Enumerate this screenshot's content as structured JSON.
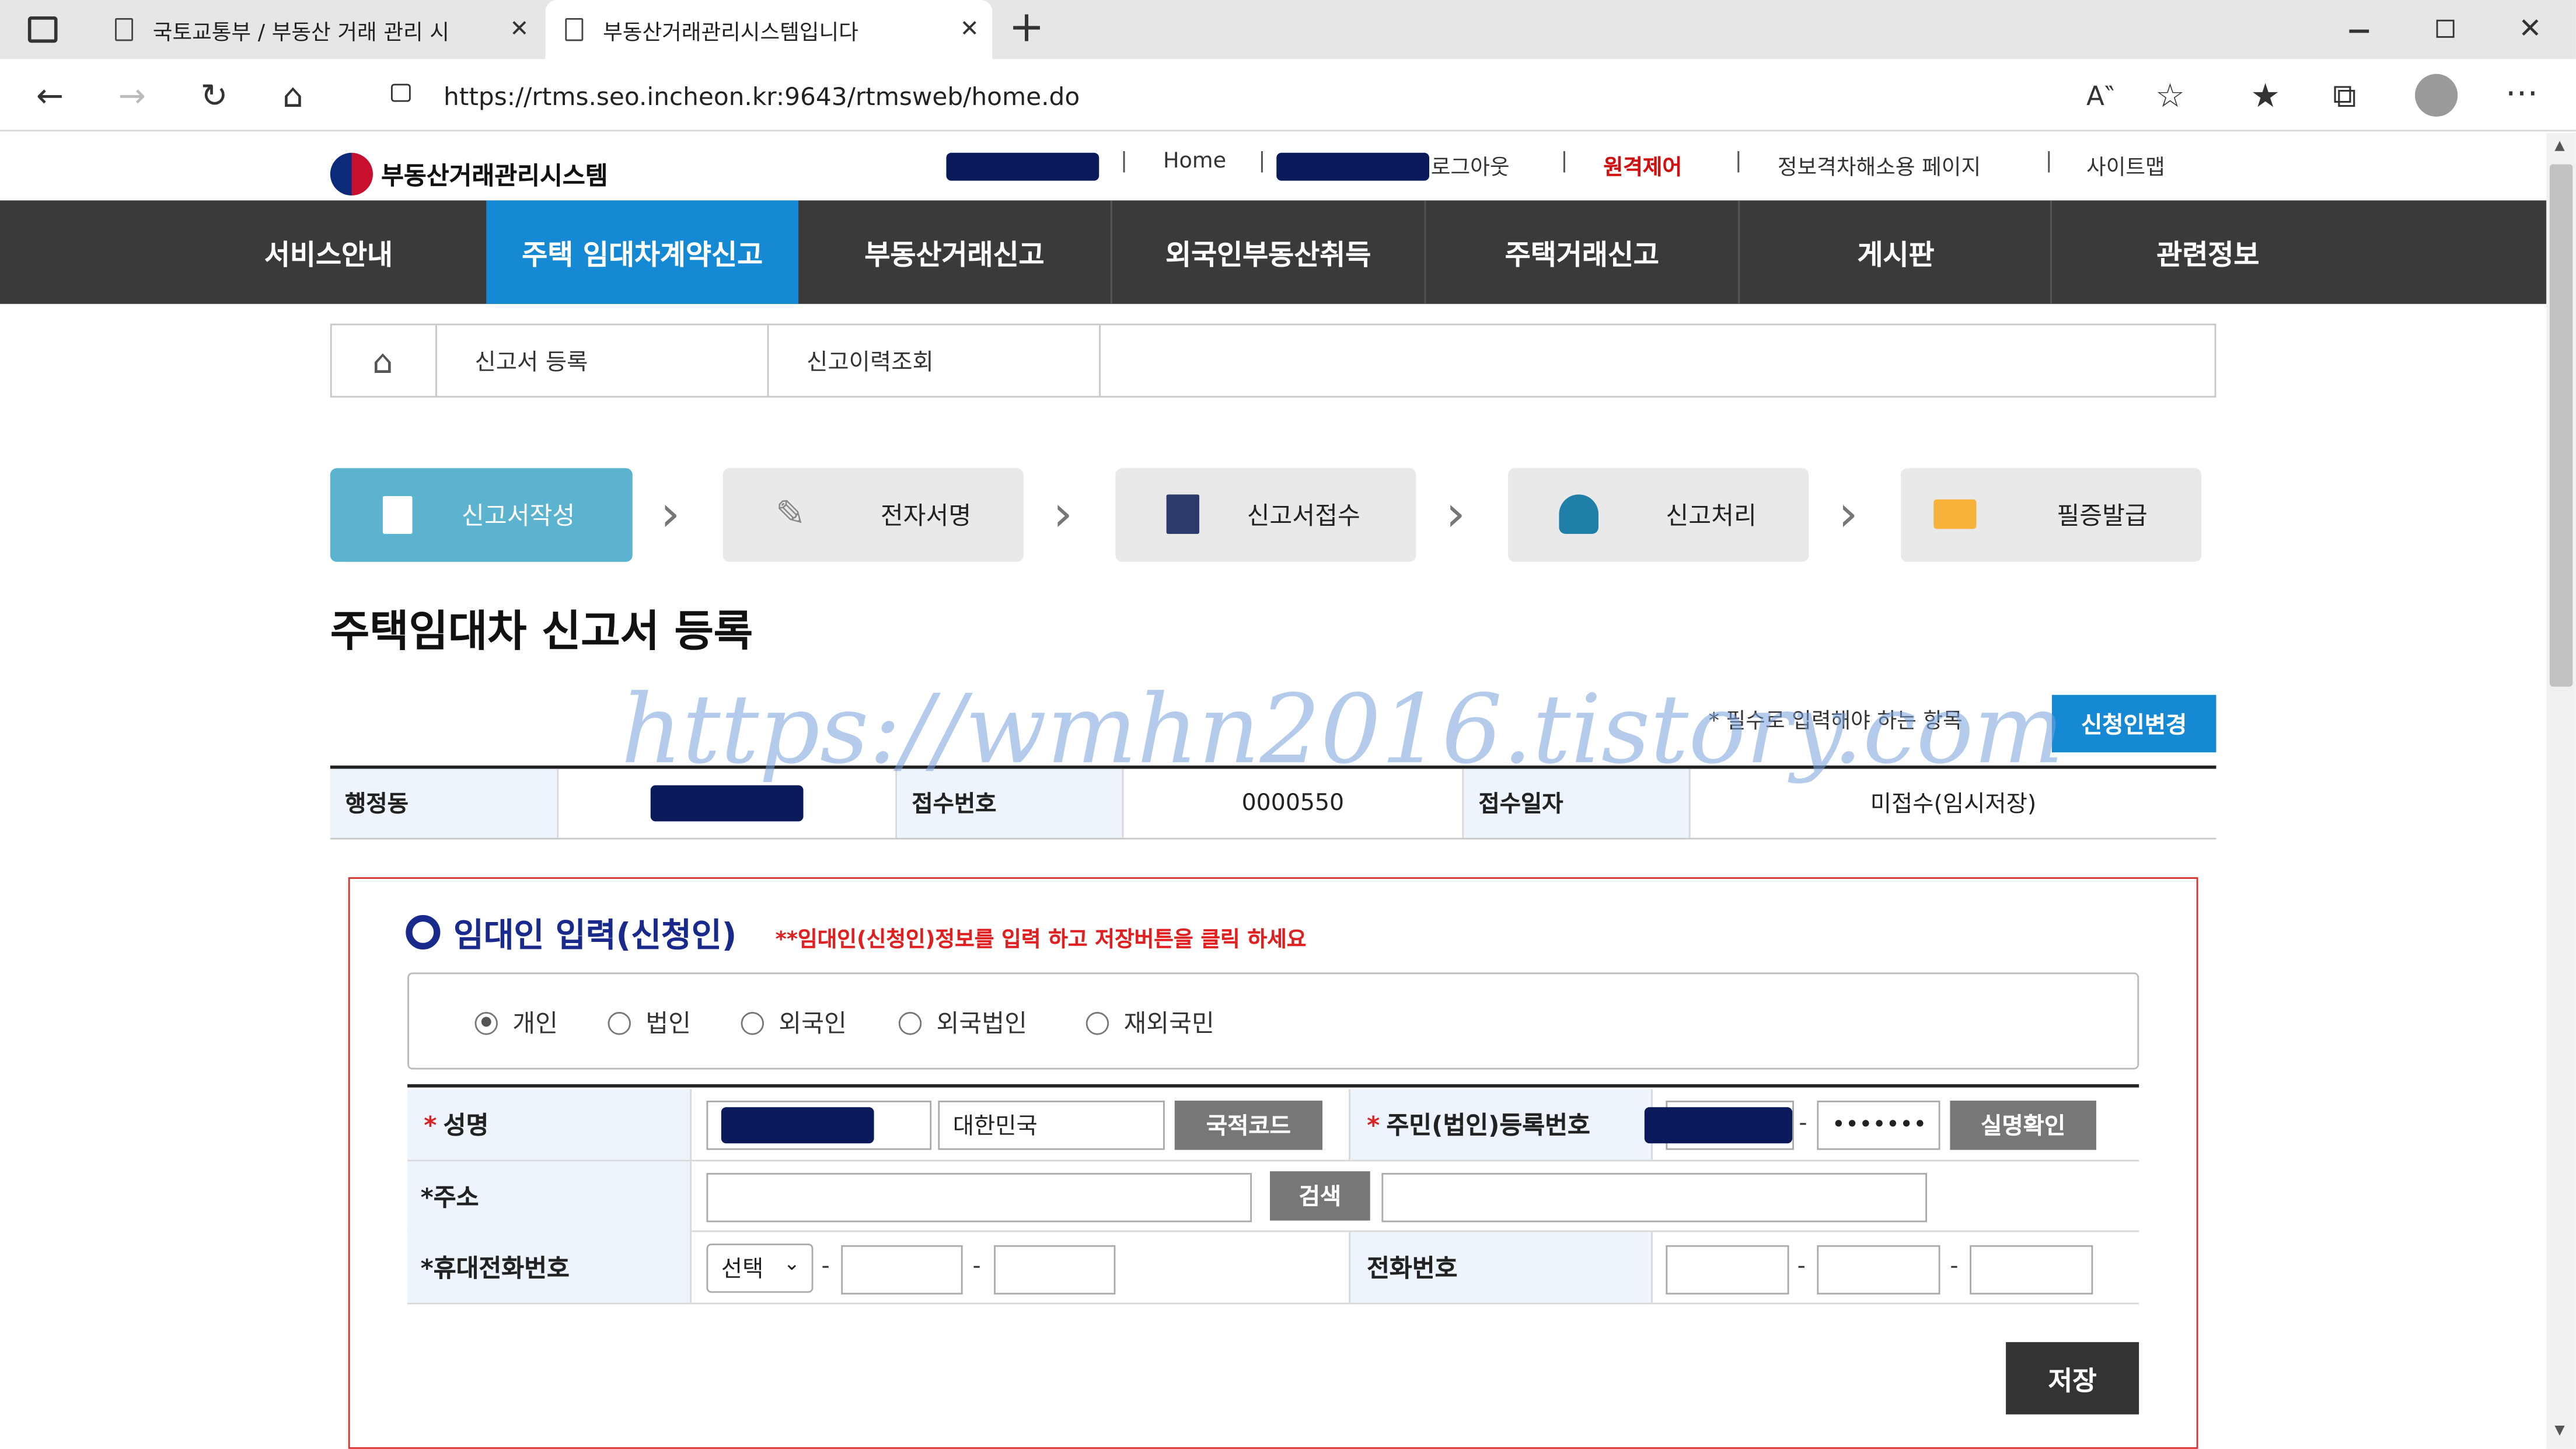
{
  "browser": {
    "tabs": [
      {
        "title": "국토교통부 / 부동산 거래 관리 시"
      },
      {
        "title": "부동산거래관리시스템입니다"
      }
    ],
    "url": "https://rtms.seo.incheon.kr:9643/rtmsweb/home.do",
    "close_glyph": "✕",
    "add_glyph": "+"
  },
  "site": {
    "logo_text": "부동산거래관리시스템",
    "util_links": [
      {
        "label": "Home"
      },
      {
        "label": "로그아웃"
      },
      {
        "label": "원격제어"
      },
      {
        "label": "정보격차해소용 페이지"
      },
      {
        "label": "사이트맵"
      }
    ],
    "gnb": [
      {
        "label": "서비스안내"
      },
      {
        "label": "주택 임대차계약신고"
      },
      {
        "label": "부동산거래신고"
      },
      {
        "label": "외국인부동산취득"
      },
      {
        "label": "주택거래신고"
      },
      {
        "label": "게시판"
      },
      {
        "label": "관련정보"
      }
    ],
    "lnb": [
      {
        "label": "신고서 등록"
      },
      {
        "label": "신고이력조회"
      }
    ]
  },
  "steps": [
    {
      "label": "신고서작성"
    },
    {
      "label": "전자서명"
    },
    {
      "label": "신고서접수"
    },
    {
      "label": "신고처리"
    },
    {
      "label": "필증발급"
    }
  ],
  "page": {
    "title": "주택임대차 신고서 등록",
    "required_note": "* 필수로 입력해야 하는 항목",
    "change_applicant": "신청인변경",
    "watermark": "https://wmhn2016.tistory.com"
  },
  "info": {
    "dong_label": "행정동",
    "receipt_no_label": "접수번호",
    "receipt_no": "0000550",
    "receipt_date_label": "접수일자",
    "receipt_date": "미접수(임시저장)"
  },
  "section": {
    "title": "임대인 입력(신청인)",
    "note": "**임대인(신청인)정보를 입력 하고 저장버튼을 클릭 하세요",
    "types": [
      {
        "label": "개인",
        "checked": true
      },
      {
        "label": "법인"
      },
      {
        "label": "외국인"
      },
      {
        "label": "외국법인"
      },
      {
        "label": "재외국민"
      }
    ]
  },
  "form": {
    "name_label": "성명",
    "nationality": "대한민국",
    "nation_code_btn": "국적코드",
    "reg_no_label": "주민(법인)등록번호",
    "reg_no_masked": "•••••••",
    "verify_btn": "실명확인",
    "address_label": "*주소",
    "search_btn": "검색",
    "mobile_label": "*휴대전화번호",
    "mobile_select": "선택",
    "phone_label": "전화번호",
    "dash": "-",
    "star": "*",
    "save_btn": "저장"
  }
}
